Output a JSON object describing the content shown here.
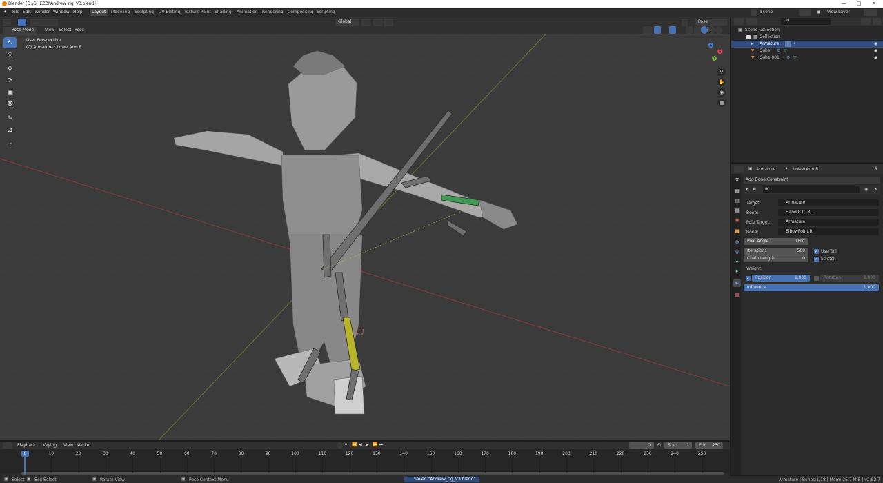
{
  "window": {
    "title": "Blender [D:\\GHEZZI\\Andrew_rig_V3.blend]"
  },
  "menus": [
    "File",
    "Edit",
    "Render",
    "Window",
    "Help"
  ],
  "workspaces": [
    "Layout",
    "Modeling",
    "Sculpting",
    "UV Editing",
    "Texture Paint",
    "Shading",
    "Animation",
    "Rendering",
    "Compositing",
    "Scripting"
  ],
  "active_workspace": "Layout",
  "scene": {
    "label": "Scene",
    "view_layer": "View Layer"
  },
  "viewport": {
    "mode": "Pose Mode",
    "menus": [
      "View",
      "Select",
      "Pose"
    ],
    "orientation": "Global",
    "pose_options": "Pose Options",
    "info_line1": "User Perspective",
    "info_line2": "(0) Armature : LowerArm.R",
    "gizmo_axes": [
      "X",
      "Y",
      "Z"
    ]
  },
  "outliner": {
    "root": "Scene Collection",
    "collection": "Collection",
    "items": [
      {
        "name": "Armature",
        "selected": true
      },
      {
        "name": "Cube",
        "selected": false
      },
      {
        "name": "Cube.001",
        "selected": false
      }
    ]
  },
  "properties": {
    "breadcrumb_object": "Armature",
    "breadcrumb_bone": "LowerArm.R",
    "add_constraint": "Add Bone Constraint",
    "constraint_name": "IK",
    "target_label": "Target:",
    "target_value": "Armature",
    "bone_label": "Bone:",
    "bone_value": "Hand.R.CTRL",
    "pole_target_label": "Pole Target:",
    "pole_target_value": "Armature",
    "pole_bone_label": "Bone:",
    "pole_bone_value": "ElbowPoint.R",
    "pole_angle_label": "Pole Angle",
    "pole_angle_value": "180°",
    "iterations_label": "Iterations",
    "iterations_value": "500",
    "chain_length_label": "Chain Length",
    "chain_length_value": "0",
    "use_tail": "Use Tail",
    "stretch": "Stretch",
    "weight_label": "Weight:",
    "position_label": "Position",
    "position_value": "1.000",
    "rotation_label": "Rotation",
    "rotation_value": "1.000",
    "influence_label": "Influence",
    "influence_value": "1.000"
  },
  "timeline": {
    "menus": [
      "Playback",
      "Keying",
      "View",
      "Marker"
    ],
    "current_frame": "0",
    "start_label": "Start",
    "start_value": "1",
    "end_label": "End",
    "end_value": "250",
    "ticks": [
      "0",
      "10",
      "20",
      "30",
      "40",
      "50",
      "60",
      "70",
      "80",
      "90",
      "100",
      "110",
      "120",
      "130",
      "140",
      "150",
      "160",
      "170",
      "180",
      "190",
      "200",
      "210",
      "220",
      "230",
      "240",
      "250"
    ]
  },
  "statusbar": {
    "select": "Select",
    "box_select": "Box Select",
    "rotate_view": "Rotate View",
    "pose_context_menu": "Pose Context Menu",
    "saved_message": "Saved \"Andrew_rig_V3.blend\"",
    "stats": "Armature | Bones:1/18  |  Mem: 25.7 MiB | v2.82.7"
  }
}
